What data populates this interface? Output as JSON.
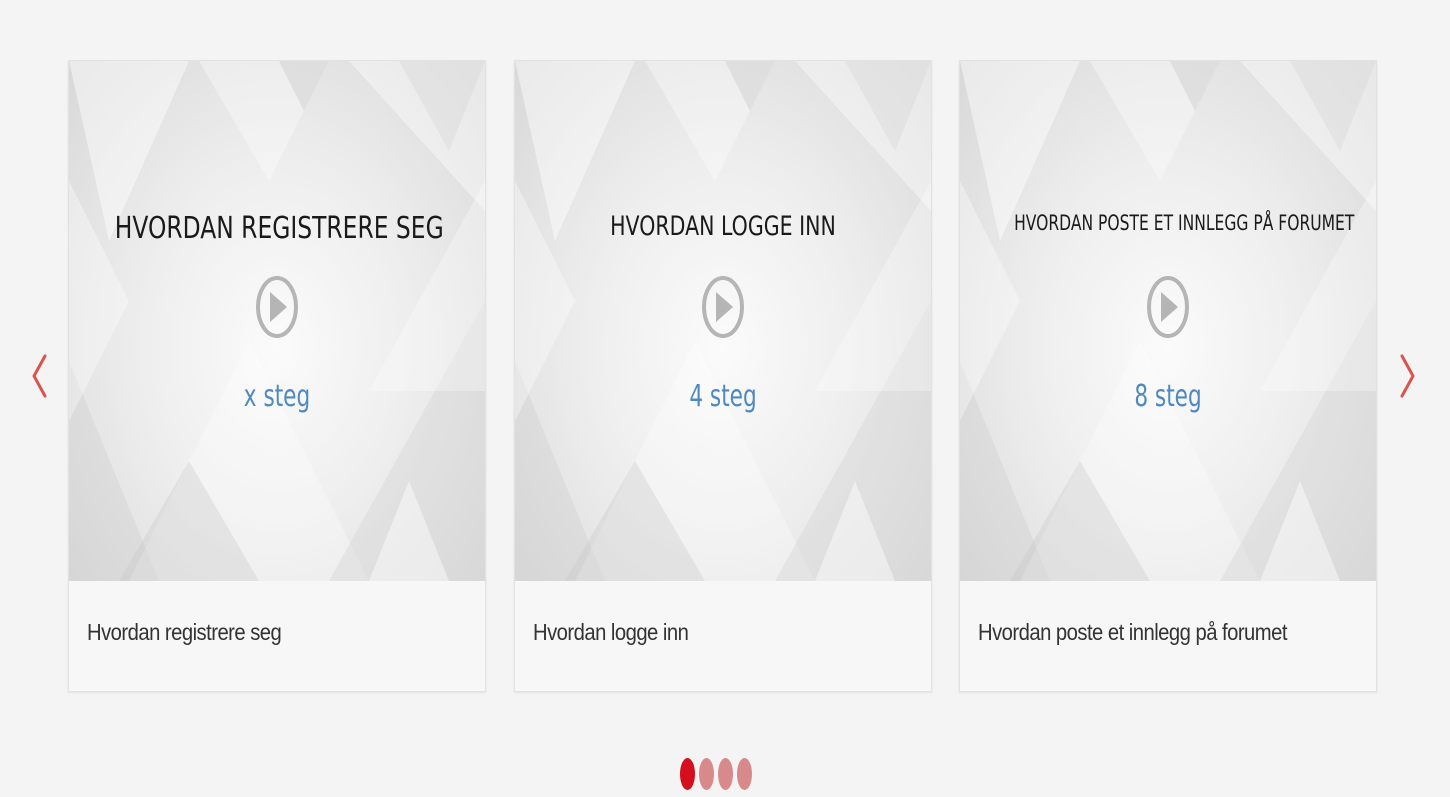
{
  "carousel": {
    "prev_icon": "chevron-left-icon",
    "next_icon": "chevron-right-icon",
    "arrow_color": "#d9534f",
    "cards": [
      {
        "thumb_title": "HVORDAN REGISTRERE SEG",
        "play_icon": "play-circle-icon",
        "steps": "x steg",
        "caption": "Hvordan registrere seg"
      },
      {
        "thumb_title": "HVORDAN LOGGE INN",
        "play_icon": "play-circle-icon",
        "steps": "4 steg",
        "caption": "Hvordan logge inn"
      },
      {
        "thumb_title": "HVORDAN POSTE ET INNLEGG PÅ FORUMET",
        "play_icon": "play-circle-icon",
        "steps": "8 steg",
        "caption": "Hvordan poste et innlegg på forumet"
      }
    ],
    "pagination": {
      "count": 4,
      "active_index": 0,
      "active_color": "#d40f1e",
      "inactive_color": "#d88a8a"
    }
  }
}
